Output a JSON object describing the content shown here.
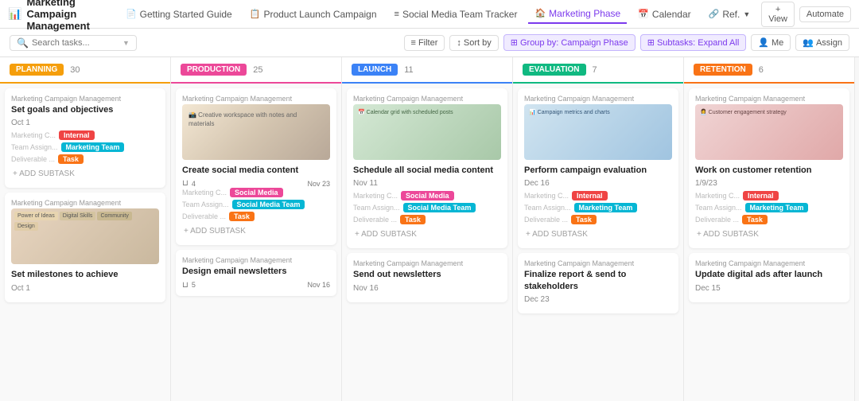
{
  "app": {
    "icon": "📊",
    "title": "Marketing Campaign Management"
  },
  "tabs": [
    {
      "label": "Getting Started Guide",
      "icon": "📄",
      "active": false
    },
    {
      "label": "Product Launch Campaign",
      "icon": "📋",
      "active": false
    },
    {
      "label": "Social Media Team Tracker",
      "icon": "≡",
      "active": false
    },
    {
      "label": "Marketing Phase",
      "icon": "🏠",
      "active": true
    },
    {
      "label": "Calendar",
      "icon": "📅",
      "active": false
    },
    {
      "label": "Ref.",
      "icon": "🔗",
      "active": false
    }
  ],
  "topbar_actions": [
    {
      "label": "+ View"
    },
    {
      "label": "Automate"
    }
  ],
  "search": {
    "placeholder": "Search tasks..."
  },
  "filter_actions": [
    {
      "label": "Filter",
      "icon": "≡"
    },
    {
      "label": "Sort by",
      "icon": "↕"
    },
    {
      "label": "Group by: Campaign Phase",
      "icon": "⊞",
      "active": true
    },
    {
      "label": "Subtasks: Expand All",
      "icon": "⊞",
      "active": true
    },
    {
      "label": "Me"
    },
    {
      "label": "Assign"
    }
  ],
  "columns": [
    {
      "id": "planning",
      "phase": "PLANNING",
      "badge_class": "badge-planning",
      "header_class": "planning",
      "count": 30,
      "cards": [
        {
          "meta": "Marketing Campaign Management",
          "title": "Set goals and objectives",
          "date": "Oct 1",
          "rows": [
            {
              "label": "Marketing C...",
              "tags": [
                {
                  "text": "Internal",
                  "class": "tag-internal"
                }
              ]
            },
            {
              "label": "Team Assign...",
              "tags": [
                {
                  "text": "Marketing Team",
                  "class": "tag-marketing-team"
                }
              ]
            },
            {
              "label": "Deliverable ...",
              "tags": [
                {
                  "text": "Task",
                  "class": "tag-task"
                }
              ]
            }
          ],
          "has_image": false,
          "add_subtask": true
        },
        {
          "meta": "Marketing Campaign Management",
          "title": "Set milestones to achieve",
          "date": "Oct 1",
          "has_image": true,
          "image_class": "img-milestones",
          "rows": [],
          "add_subtask": false
        }
      ]
    },
    {
      "id": "production",
      "phase": "PRODUCTION",
      "badge_class": "badge-production",
      "header_class": "production",
      "count": 25,
      "cards": [
        {
          "meta": "Marketing Campaign Management",
          "title": "Create social media content",
          "date": "Nov 23",
          "has_image": true,
          "image_class": "img-social-content",
          "subtask_count": 4,
          "rows": [
            {
              "label": "Marketing C...",
              "tags": [
                {
                  "text": "Social Media",
                  "class": "tag-social-media"
                }
              ]
            },
            {
              "label": "Team Assign...",
              "tags": [
                {
                  "text": "Social Media Team",
                  "class": "tag-social-media-team"
                }
              ]
            },
            {
              "label": "Deliverable ...",
              "tags": [
                {
                  "text": "Task",
                  "class": "tag-task"
                }
              ]
            }
          ],
          "add_subtask": true
        },
        {
          "meta": "Marketing Campaign Management",
          "title": "Design email newsletters",
          "date": "Nov 16",
          "has_image": false,
          "subtask_count": 5,
          "rows": [],
          "add_subtask": false
        }
      ]
    },
    {
      "id": "launch",
      "phase": "LAUNCH",
      "badge_class": "badge-launch",
      "header_class": "launch",
      "count": 11,
      "cards": [
        {
          "meta": "Marketing Campaign Management",
          "title": "Schedule all social media content",
          "date": "Nov 11",
          "has_image": true,
          "image_class": "img-schedule",
          "rows": [
            {
              "label": "Marketing C...",
              "tags": [
                {
                  "text": "Social Media",
                  "class": "tag-social-media"
                }
              ]
            },
            {
              "label": "Team Assign...",
              "tags": [
                {
                  "text": "Social Media Team",
                  "class": "tag-social-media-team"
                }
              ]
            },
            {
              "label": "Deliverable ...",
              "tags": [
                {
                  "text": "Task",
                  "class": "tag-task"
                }
              ]
            }
          ],
          "add_subtask": true
        },
        {
          "meta": "Marketing Campaign Management",
          "title": "Send out newsletters",
          "date": "Nov 16",
          "has_image": false,
          "rows": [],
          "add_subtask": false
        }
      ]
    },
    {
      "id": "evaluation",
      "phase": "EVALUATION",
      "badge_class": "badge-evaluation",
      "header_class": "evaluation",
      "count": 7,
      "cards": [
        {
          "meta": "Marketing Campaign Management",
          "title": "Perform campaign evaluation",
          "date": "Dec 16",
          "has_image": true,
          "image_class": "img-evaluation",
          "rows": [
            {
              "label": "Marketing C...",
              "tags": [
                {
                  "text": "Internal",
                  "class": "tag-internal"
                }
              ]
            },
            {
              "label": "Team Assign...",
              "tags": [
                {
                  "text": "Marketing Team",
                  "class": "tag-marketing-team"
                }
              ]
            },
            {
              "label": "Deliverable ...",
              "tags": [
                {
                  "text": "Task",
                  "class": "tag-task"
                }
              ]
            }
          ],
          "add_subtask": true
        },
        {
          "meta": "Marketing Campaign Management",
          "title": "Finalize report & send to stakeholders",
          "date": "Dec 23",
          "has_image": false,
          "rows": [],
          "add_subtask": false
        }
      ]
    },
    {
      "id": "retention",
      "phase": "RETENTION",
      "badge_class": "badge-retention",
      "header_class": "retention",
      "count": 6,
      "cards": [
        {
          "meta": "Marketing Campaign Management",
          "title": "Work on customer retention",
          "date": "1/9/23",
          "has_image": true,
          "image_class": "img-retention",
          "rows": [
            {
              "label": "Marketing C...",
              "tags": [
                {
                  "text": "Internal",
                  "class": "tag-internal"
                }
              ]
            },
            {
              "label": "Team Assign...",
              "tags": [
                {
                  "text": "Marketing Team",
                  "class": "tag-marketing-team"
                }
              ]
            },
            {
              "label": "Deliverable ...",
              "tags": [
                {
                  "text": "Task",
                  "class": "tag-task"
                }
              ]
            }
          ],
          "add_subtask": true
        },
        {
          "meta": "Marketing Campaign Management",
          "title": "Update digital ads after launch",
          "date": "Dec 15",
          "has_image": false,
          "rows": [],
          "add_subtask": false
        }
      ]
    }
  ]
}
